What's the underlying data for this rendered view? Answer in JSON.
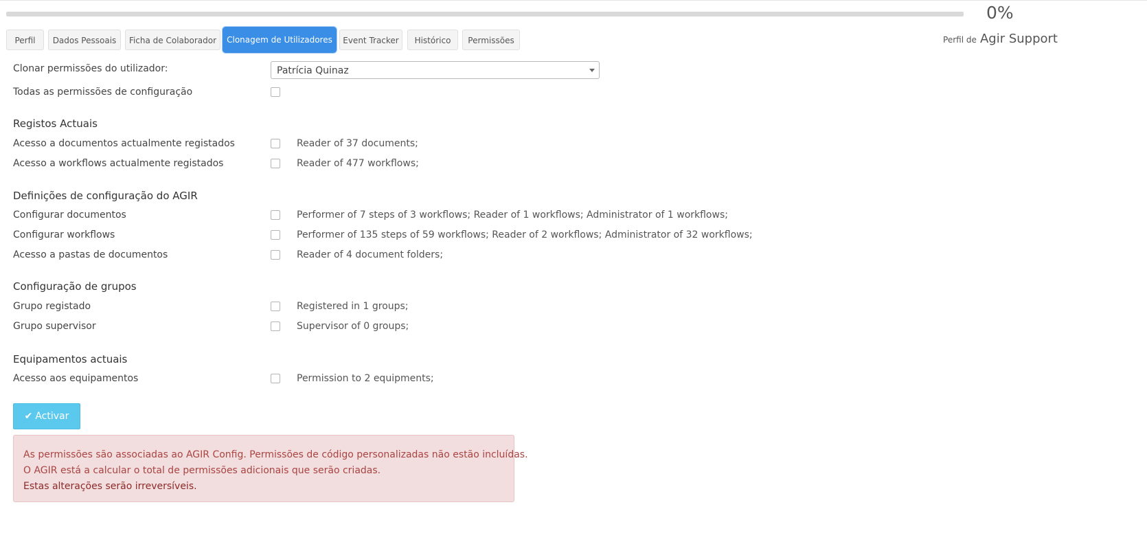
{
  "progress": {
    "value_percent": 0,
    "label": "0%"
  },
  "profile": {
    "prefix": "Perfil de",
    "name": "Agir Support"
  },
  "tabs": [
    {
      "label": "Perfil"
    },
    {
      "label": "Dados Pessoais"
    },
    {
      "label": "Ficha de Colaborador"
    },
    {
      "label": "Clonagem de Utilizadores",
      "active": true
    },
    {
      "label": "Event Tracker"
    },
    {
      "label": "Histórico"
    },
    {
      "label": "Permissões"
    }
  ],
  "clone": {
    "label": "Clonar permissões do utilizador:",
    "selected_user": "Patrícia Quinaz",
    "all_config_label": "Todas as permissões de configuração"
  },
  "sections": {
    "current_records": {
      "title": "Registos Actuais",
      "rows": [
        {
          "label": "Acesso a documentos actualmente registados",
          "desc": "Reader of 37 documents;"
        },
        {
          "label": "Acesso a workflows actualmente registados",
          "desc": "Reader of 477 workflows;"
        }
      ]
    },
    "config": {
      "title": "Definições de configuração do AGIR",
      "rows": [
        {
          "label": "Configurar documentos",
          "desc": "Performer of 7 steps of 3 workflows; Reader of 1 workflows; Administrator of 1 workflows;"
        },
        {
          "label": "Configurar workflows",
          "desc": "Performer of 135 steps of 59 workflows; Reader of 2 workflows; Administrator of 32 workflows;"
        },
        {
          "label": "Acesso a pastas de documentos",
          "desc": "Reader of 4 document folders;"
        }
      ]
    },
    "groups": {
      "title": "Configuração de grupos",
      "rows": [
        {
          "label": "Grupo registado",
          "desc": "Registered in 1 groups;"
        },
        {
          "label": "Grupo supervisor",
          "desc": "Supervisor of 0 groups;"
        }
      ]
    },
    "equipment": {
      "title": "Equipamentos actuais",
      "rows": [
        {
          "label": "Acesso aos equipamentos",
          "desc": "Permission to 2 equipments;"
        }
      ]
    }
  },
  "actions": {
    "activate_label": "Activar",
    "activate_icon": "check-icon"
  },
  "alert": {
    "line1": "As permissões são associadas ao AGIR Config. Permissões de código personalizadas não estão incluídas.",
    "line2": "O AGIR está a calcular o total de permissões adicionais que serão criadas.",
    "line3": "Estas alterações serão irreversíveis."
  },
  "colors": {
    "accent": "#3a8ee6",
    "button": "#5bc8ee",
    "alert_bg": "#f2dede",
    "alert_text": "#a94442"
  }
}
